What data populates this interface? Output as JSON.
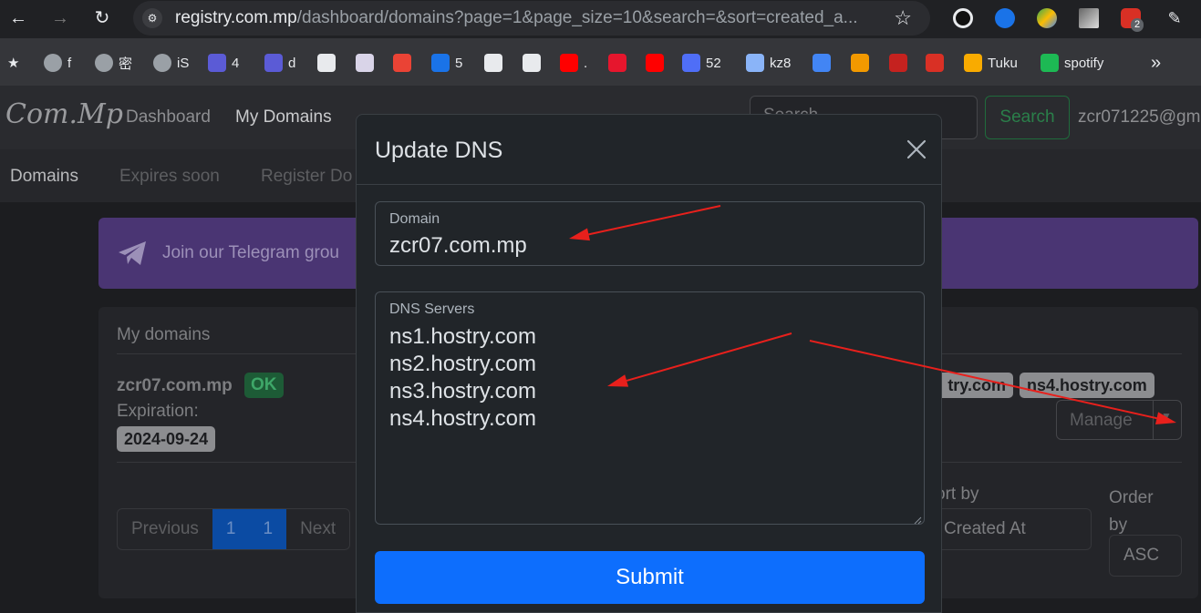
{
  "browser": {
    "url_host": "registry.com.mp",
    "url_rest": "/dashboard/domains?page=1&page_size=10&search=&sort=created_a...",
    "extension_badge": "2",
    "bookmarks": [
      {
        "label": "f",
        "icon": "globe-icon",
        "color": "#9aa0a6"
      },
      {
        "label": "密",
        "icon": "globe-icon",
        "color": "#9aa0a6"
      },
      {
        "label": "iS",
        "icon": "globe-icon",
        "color": "#9aa0a6"
      },
      {
        "label": "4",
        "icon": "ghost-icon",
        "color": "#5b5bd6"
      },
      {
        "label": "d",
        "icon": "ghost-icon",
        "color": "#5b5bd6"
      },
      {
        "label": "",
        "icon": "chatgpt-icon",
        "color": "#e8eaed"
      },
      {
        "label": "",
        "icon": "terminal-icon",
        "color": "#d9d4e8"
      },
      {
        "label": "",
        "icon": "gmail-icon",
        "color": "#ea4335"
      },
      {
        "label": "5",
        "icon": "onedrive-icon",
        "color": "#1a73e8"
      },
      {
        "label": "",
        "icon": "github-icon",
        "color": "#e8eaed"
      },
      {
        "label": "",
        "icon": "google-icon",
        "color": "#e8eaed"
      },
      {
        "label": ".",
        "icon": "youtube-icon",
        "color": "#ff0000"
      },
      {
        "label": "",
        "icon": "weibo-icon",
        "color": "#e6162d"
      },
      {
        "label": "",
        "icon": "youtube-icon",
        "color": "#ff0000"
      },
      {
        "label": "52",
        "icon": "app-icon",
        "color": "#4f6ef7"
      },
      {
        "label": "kz8",
        "icon": "mountain-icon",
        "color": "#8ab4f8"
      },
      {
        "label": "",
        "icon": "cloud-icon",
        "color": "#4285f4"
      },
      {
        "label": "",
        "icon": "orange-icon",
        "color": "#f29900"
      },
      {
        "label": "",
        "icon": "box-icon",
        "color": "#c5221f"
      },
      {
        "label": "",
        "icon": "seal-icon",
        "color": "#d93025"
      },
      {
        "label": "Tuku",
        "icon": "flower-icon",
        "color": "#f9ab00"
      },
      {
        "label": "spotify",
        "icon": "spotify-icon",
        "color": "#1db954"
      }
    ],
    "more": "»"
  },
  "nav": {
    "logo": "Com.Mp",
    "dashboard": "Dashboard",
    "my_domains": "My Domains",
    "search_placeholder": "Search",
    "search_button": "Search",
    "user": "zcr071225@gm"
  },
  "subnav": {
    "domains": "Domains",
    "expires_soon": "Expires soon",
    "register": "Register Do"
  },
  "banner": {
    "text": "Join our Telegram grou"
  },
  "card": {
    "title": "My domains",
    "domain": "zcr07.com.mp",
    "status": "OK",
    "expiration_label": "Expiration:",
    "expiration_date": "2024-09-24",
    "ns_badges": [
      "try.com",
      "ns4.hostry.com"
    ],
    "manage": "Manage",
    "pagination": [
      "Previous",
      "1",
      "1",
      "Next"
    ],
    "sort_by_label": "ort by",
    "sort_by_value": "Created At",
    "order_by_label": "Order by",
    "order_by_value": "ASC"
  },
  "modal": {
    "title": "Update DNS",
    "domain_label": "Domain",
    "domain_value": "zcr07.com.mp",
    "dns_label": "DNS Servers",
    "dns_servers": [
      "ns1.hostry.com",
      "ns2.hostry.com",
      "ns3.hostry.com",
      "ns4.hostry.com"
    ],
    "submit": "Submit"
  },
  "annotation_color": "#e8201c"
}
